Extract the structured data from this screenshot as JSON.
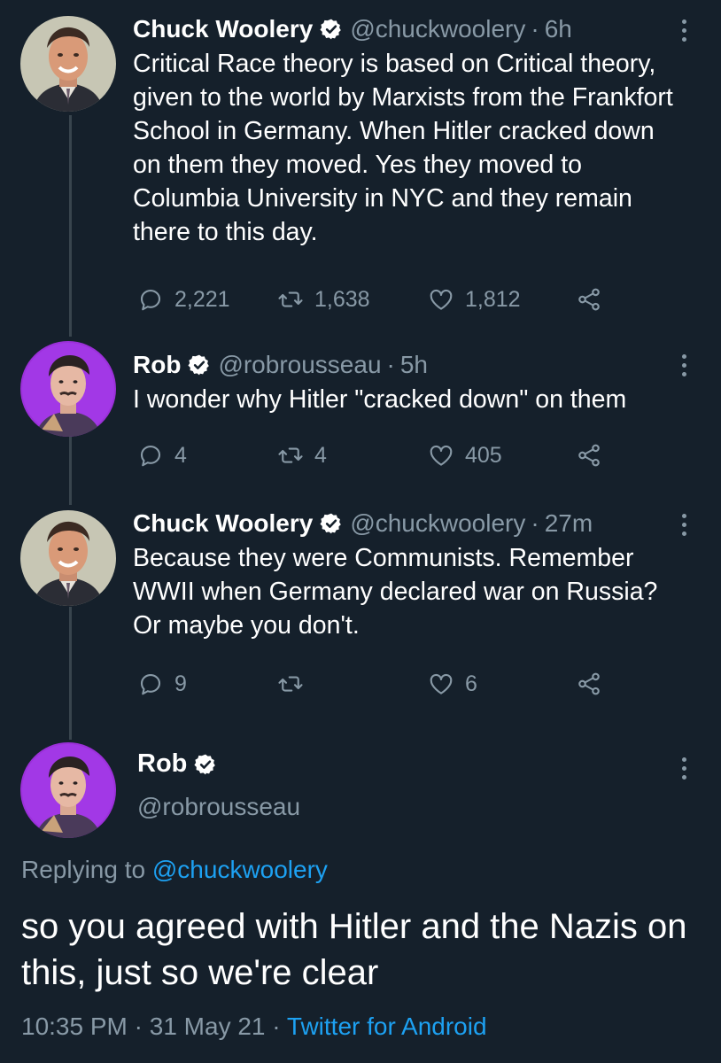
{
  "tweets": [
    {
      "name": "Chuck Woolery",
      "handle": "@chuckwoolery",
      "separator": "·",
      "time": "6h",
      "text": "Critical Race theory is based on Critical theory, given to the world by Marxists from the Frankfort School in Germany. When Hitler cracked down on them they moved. Yes they moved to Columbia University in NYC and they remain there to this day.",
      "replies": "2,221",
      "retweets": "1,638",
      "likes": "1,812"
    },
    {
      "name": "Rob",
      "handle": "@robrousseau",
      "separator": "·",
      "time": "5h",
      "text": "I wonder why Hitler \"cracked down\" on them",
      "replies": "4",
      "retweets": "4",
      "likes": "405"
    },
    {
      "name": "Chuck Woolery",
      "handle": "@chuckwoolery",
      "separator": "·",
      "time": "27m",
      "text": "Because they were Communists. Remember WWII when Germany declared war on Russia? Or maybe you don't.",
      "replies": "9",
      "retweets": "",
      "likes": "6"
    }
  ],
  "main_tweet": {
    "name": "Rob",
    "handle": "@robrousseau",
    "replying_prefix": "Replying to ",
    "replying_to": "@chuckwoolery",
    "text": "so you agreed with Hitler and the Nazis on this, just so we're clear",
    "time": "10:35 PM",
    "separator1": " · ",
    "date": "31 May 21",
    "separator2": " · ",
    "source": "Twitter for Android"
  },
  "icons": {
    "reply": "reply-icon",
    "retweet": "retweet-icon",
    "like": "heart-icon",
    "share": "share-icon",
    "verified": "verified-badge-icon",
    "more": "more-vertical-icon"
  },
  "colors": {
    "background": "#15202b",
    "muted": "#8899a6",
    "link": "#1da1f2",
    "thread_line": "#38444d"
  }
}
